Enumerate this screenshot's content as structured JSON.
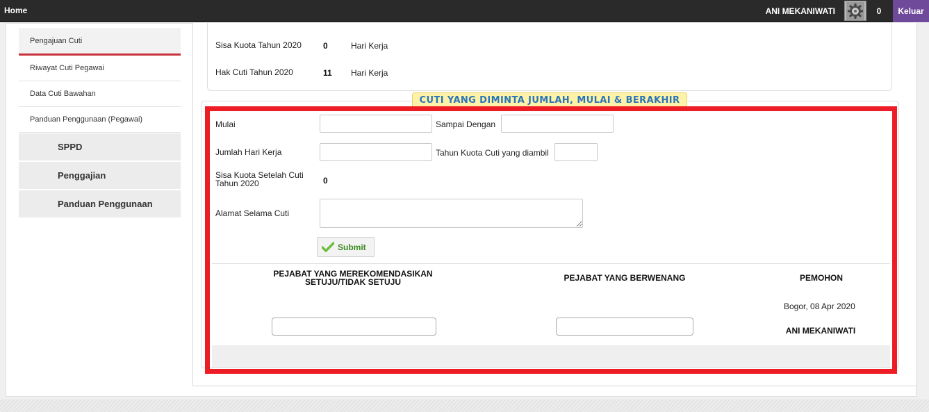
{
  "topbar": {
    "home": "Home",
    "username": "ANI MEKANIWATI",
    "notifications": "0",
    "logout": "Keluar"
  },
  "sidebar": {
    "items": [
      "Pengajuan Cuti",
      "Riwayat Cuti Pegawai",
      "Data Cuti Bawahan",
      "Panduan Penggunaan (Pegawai)"
    ],
    "sections": [
      "SPPD",
      "Penggajian",
      "Panduan Penggunaan"
    ]
  },
  "quota": {
    "sisa_label": "Sisa Kuota Tahun 2020",
    "sisa_value": "0",
    "sisa_unit": "Hari Kerja",
    "hak_label": "Hak Cuti Tahun 2020",
    "hak_value": "11",
    "hak_unit": "Hari Kerja"
  },
  "section_title": "CUTI YANG DIMINTA JUMLAH, MULAI & BERAKHIR",
  "form": {
    "mulai_label": "Mulai",
    "mulai_value": "",
    "sampai_label": "Sampai Dengan",
    "sampai_value": "",
    "jumlah_label": "Jumlah Hari Kerja",
    "jumlah_value": "",
    "tahun_kuota_label": "Tahun Kuota Cuti yang diambil",
    "tahun_kuota_value": "",
    "sisa_setelah_label_1": "Sisa Kuota Setelah Cuti",
    "sisa_setelah_label_2": "Tahun 2020",
    "sisa_setelah_value": "0",
    "alamat_label": "Alamat Selama Cuti",
    "alamat_value": "",
    "submit_label": "Submit"
  },
  "signatures": {
    "rekomendasi_line1": "PEJABAT YANG MEREKOMENDASIKAN",
    "rekomendasi_line2": "SETUJU/TIDAK SETUJU",
    "berwenang": "PEJABAT YANG BERWENANG",
    "pemohon": "PEMOHON",
    "place_date": "Bogor, 08 Apr 2020",
    "pemohon_name": "ANI MEKANIWATI",
    "rekomendasi_value": "",
    "berwenang_value": ""
  },
  "colors": {
    "topbar": "#2a2a2a",
    "logout_bg": "#6f4a9a",
    "active_marker": "#c8313b",
    "section_title_bg": "#fdf2a8",
    "section_title_text": "#2b76b9",
    "highlight_box": "#ee1c24",
    "submit_text": "#3b8a1f"
  },
  "icons": {
    "avatar": "gear-avatar-icon",
    "submit": "checkmark-icon"
  }
}
